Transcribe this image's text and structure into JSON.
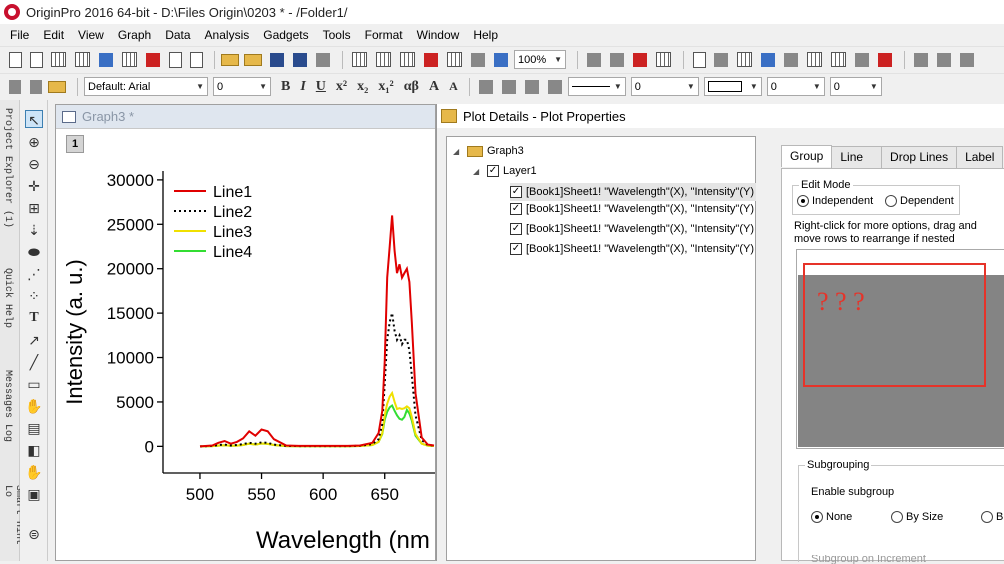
{
  "app": {
    "title": "OriginPro 2016 64-bit - D:\\Files Origin\\0203 * - /Folder1/"
  },
  "menu": [
    "File",
    "Edit",
    "View",
    "Graph",
    "Data",
    "Analysis",
    "Gadgets",
    "Tools",
    "Format",
    "Window",
    "Help"
  ],
  "toolbar": {
    "zoom": "100%",
    "font": "Default: Arial",
    "font_size": "0",
    "size_b": "0",
    "size_c": "0",
    "size_d": "0",
    "format_buttons": [
      "B",
      "I",
      "U",
      "x²",
      "x₂",
      "x₁²",
      "αβ",
      "A",
      "A"
    ]
  },
  "left_tabs": [
    "Project Explorer (1)",
    "Quick Help",
    "Messages Log",
    "Smart Hint Lo"
  ],
  "graph": {
    "window_title": "Graph3 *",
    "layer_button": "1"
  },
  "dialog": {
    "title": "Plot Details - Plot Properties",
    "tree": {
      "root": "Graph3",
      "layer": "Layer1",
      "plots": [
        "[Book1]Sheet1! \"Wavelength\"(X), \"Intensity\"(Y)",
        "[Book1]Sheet1! \"Wavelength\"(X), \"Intensity\"(Y)",
        "[Book1]Sheet1! \"Wavelength\"(X), \"Intensity\"(Y)",
        "[Book1]Sheet1! \"Wavelength\"(X), \"Intensity\"(Y)"
      ]
    },
    "tabs": [
      "Group",
      "Line",
      "Drop Lines",
      "Label"
    ],
    "edit_mode": {
      "label": "Edit Mode",
      "independent": "Independent",
      "dependent": "Dependent"
    },
    "hint": "Right-click for more options, drag and move rows to  rearrange if nested",
    "annotation": "? ? ?",
    "subgrouping": {
      "label": "Subgrouping",
      "enable": "Enable subgroup",
      "none": "None",
      "by_size": "By Size",
      "by_other": "B",
      "increment": "Subgroup on Increment"
    }
  },
  "chart_data": {
    "type": "line",
    "xlabel": "Wavelength (nm",
    "ylabel": "Intensity (a. u.)",
    "xlim": [
      470,
      690
    ],
    "ylim": [
      -3000,
      31000
    ],
    "xticks": [
      "500",
      "550",
      "600",
      "650"
    ],
    "yticks": [
      "0",
      "5000",
      "10000",
      "15000",
      "20000",
      "25000",
      "30000"
    ],
    "x": [
      500,
      510,
      515,
      520,
      525,
      530,
      535,
      540,
      545,
      550,
      555,
      560,
      570,
      580,
      600,
      620,
      630,
      640,
      645,
      648,
      650,
      652,
      654,
      656,
      658,
      660,
      662,
      664,
      666,
      668,
      670,
      672,
      675,
      680,
      685,
      690
    ],
    "series": [
      {
        "name": "Line1",
        "color": "#e00000",
        "style": "solid",
        "values": [
          0,
          100,
          400,
          600,
          300,
          500,
          900,
          1700,
          1200,
          1900,
          1700,
          800,
          100,
          50,
          50,
          50,
          100,
          400,
          1500,
          4000,
          9500,
          19000,
          22500,
          26000,
          22000,
          19500,
          20500,
          19000,
          19500,
          20000,
          18500,
          14000,
          6000,
          1000,
          200,
          100
        ]
      },
      {
        "name": "Line2",
        "color": "#000000",
        "style": "dotted",
        "values": [
          0,
          50,
          150,
          200,
          100,
          150,
          250,
          400,
          300,
          450,
          400,
          200,
          50,
          30,
          30,
          30,
          60,
          250,
          800,
          2500,
          7000,
          12000,
          14000,
          15000,
          13000,
          12000,
          12500,
          11500,
          12000,
          12000,
          10800,
          8000,
          3500,
          700,
          150,
          80
        ]
      },
      {
        "name": "Line3",
        "color": "#f0e000",
        "style": "solid",
        "values": [
          0,
          30,
          80,
          120,
          60,
          90,
          150,
          300,
          200,
          320,
          280,
          150,
          30,
          20,
          20,
          20,
          40,
          150,
          500,
          1500,
          3500,
          4800,
          5600,
          6000,
          5000,
          4200,
          4300,
          4200,
          4300,
          4500,
          4300,
          3300,
          1400,
          300,
          80,
          40
        ]
      },
      {
        "name": "Line4",
        "color": "#33dd33",
        "style": "solid",
        "values": [
          0,
          30,
          80,
          120,
          60,
          90,
          150,
          300,
          200,
          320,
          280,
          150,
          30,
          20,
          20,
          20,
          40,
          150,
          500,
          1400,
          3000,
          3900,
          4400,
          4600,
          4000,
          3500,
          3100,
          3000,
          3300,
          4100,
          3700,
          2900,
          1200,
          300,
          80,
          40
        ]
      }
    ]
  }
}
